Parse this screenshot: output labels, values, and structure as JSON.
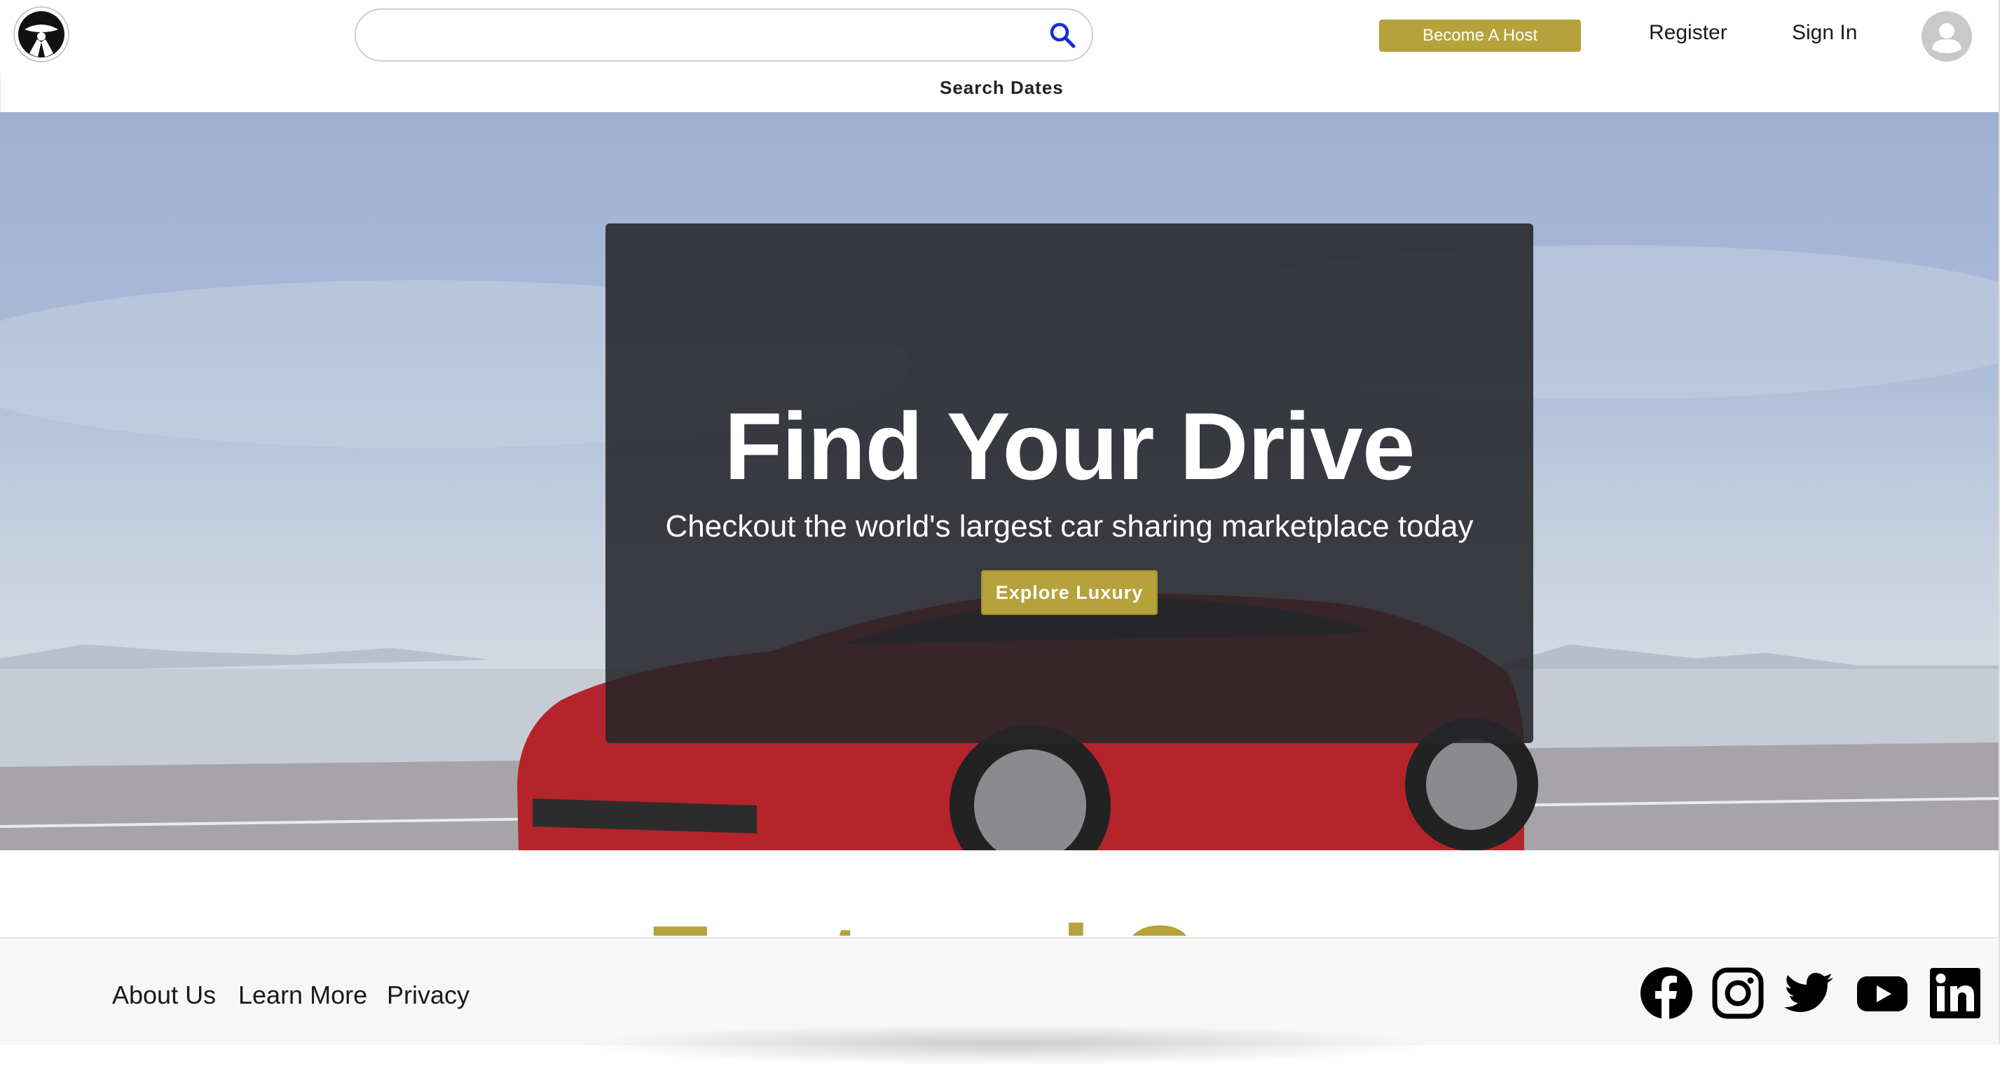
{
  "header": {
    "search_placeholder": "",
    "host_button": "Become A Host",
    "register": "Register",
    "sign_in": "Sign In",
    "search_dates": "Search Dates"
  },
  "hero": {
    "title": "Find Your Drive",
    "subtitle": "Checkout the world's largest car sharing marketplace today",
    "cta": "Explore Luxury"
  },
  "featured": {
    "heading": "Featured Cars"
  },
  "footer": {
    "links": [
      "About Us",
      "Learn More",
      "Privacy"
    ],
    "social": [
      "facebook-icon",
      "instagram-icon",
      "twitter-icon",
      "youtube-icon",
      "linkedin-icon"
    ]
  },
  "colors": {
    "accent": "#b6a23a",
    "hero_card": "#26262a",
    "footer_bg": "#f7f7f7",
    "search_icon": "#1a2bd6"
  }
}
